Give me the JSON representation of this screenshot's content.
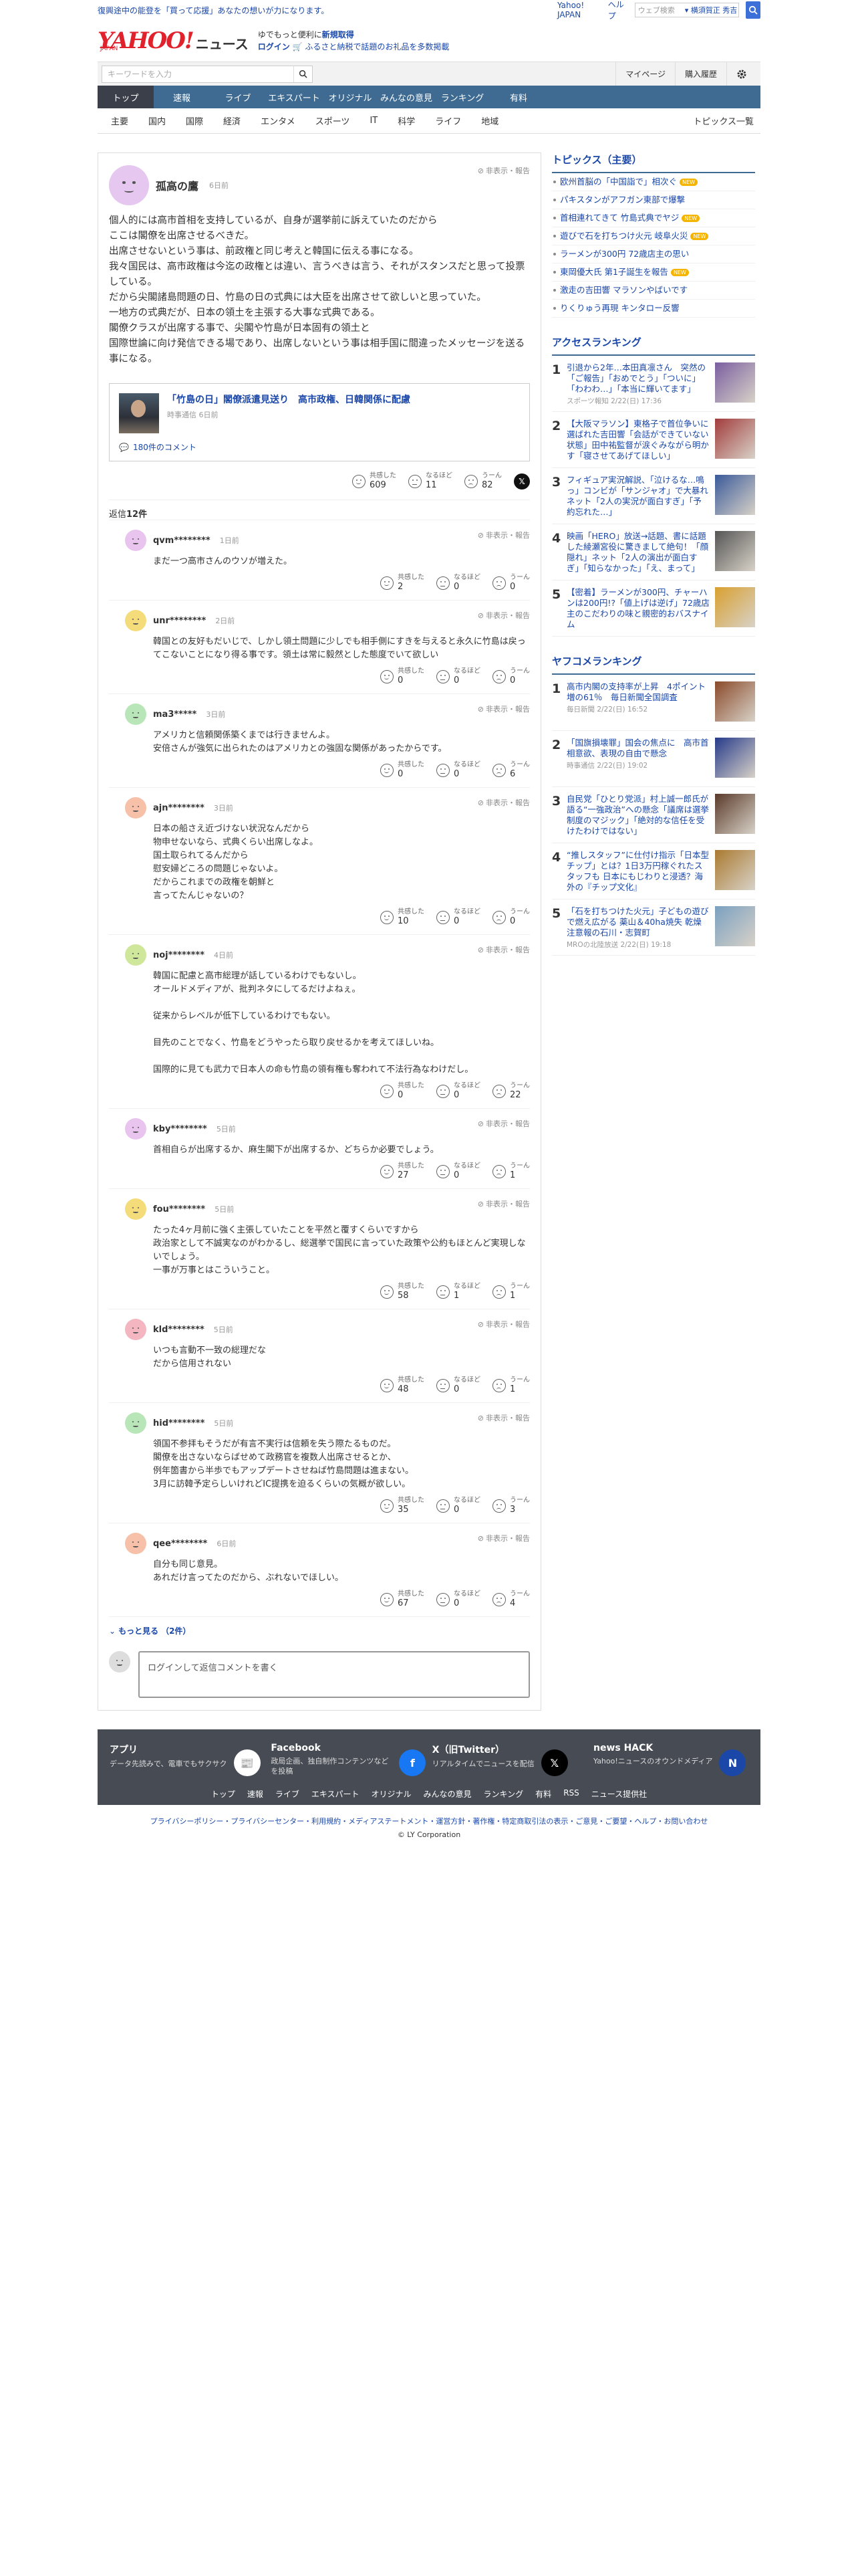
{
  "topbar": {
    "promo": "復興途中の能登を「買って応援」あなたの想いが力になります。",
    "yj": "Yahoo! JAPAN",
    "help": "ヘルプ",
    "search_ph": "ウェブ検索",
    "search_chip": "▾ 横須賀正 秀吉",
    "search_icon": "search-icon"
  },
  "logo": {
    "yahoo": "YAHOO!",
    "japan": "JAPAN",
    "news": "ニュース"
  },
  "promo": {
    "l1a": "ゆでもっと便利に",
    "l1b": "新規取得",
    "l2a": "ログイン",
    "l2b": "ふるさと納税で話題のお礼品を多数掲載"
  },
  "search": {
    "placeholder": "キーワードを入力",
    "mypage": "マイページ",
    "history": "購入履歴"
  },
  "nav": [
    "トップ",
    "速報",
    "ライブ",
    "エキスパート",
    "オリジナル",
    "みんなの意見",
    "ランキング",
    "有料"
  ],
  "subnav": [
    "主要",
    "国内",
    "国際",
    "経済",
    "エンタメ",
    "スポーツ",
    "IT",
    "科学",
    "ライフ",
    "地域"
  ],
  "subnav_last": "トピックス一覧",
  "comment": {
    "user": "孤高の鷹",
    "date": "6日前",
    "hide": "非表示・報告",
    "text": "個人的には高市首相を支持しているが、自身が選挙前に訴えていたのだから\nここは閣僚を出席させるべきだ。\n出席させないという事は、前政権と同じ考えと韓国に伝える事になる。\n我々国民は、高市政権は今迄の政権とは違い、言うべきは言う、それがスタンスだと思って投票している。\nだから尖閣諸島問題の日、竹島の日の式典には大臣を出席させて欲しいと思っていた。\n一地方の式典だが、日本の領土を主張する大事な式典である。\n閣僚クラスが出席する事で、尖閣や竹島が日本固有の領土と\n国際世論に向け発信できる場であり、出席しないという事は相手国に間違ったメッセージを送る事になる。",
    "article_title": "「竹島の日」閣僚派遣見送り　高市政権、日韓関係に配慮",
    "article_src": "時事通信 6日前",
    "article_comments": "180件のコメント",
    "reactions": {
      "agree": "共感した",
      "agree_n": "609",
      "naruhodo": "なるほど",
      "naruhodo_n": "11",
      "hmm": "うーん",
      "hmm_n": "82"
    }
  },
  "reply_label": "返信",
  "reply_count": "12件",
  "replies": [
    {
      "user": "qvm********",
      "date": "1日前",
      "color": "#e8c4ee",
      "text": "まだ一つ高市さんのウソが増えた。",
      "a": "2",
      "b": "0",
      "c": "0"
    },
    {
      "user": "unr********",
      "date": "2日前",
      "color": "#f5dc7a",
      "text": "韓国との友好もだいじで、しかし領土問題に少しでも相手側にすきを与えると永久に竹島は戻ってこないことになり得る事です。領土は常に毅然とした態度でいて欲しい",
      "a": "0",
      "b": "0",
      "c": "0"
    },
    {
      "user": "ma3*****",
      "date": "3日前",
      "color": "#b9e6b8",
      "text": "アメリカと信頼関係築くまでは行きませんよ。\n安倍さんが強気に出られたのはアメリカとの強固な関係があったからです。",
      "a": "0",
      "b": "0",
      "c": "6"
    },
    {
      "user": "ajn********",
      "date": "3日前",
      "color": "#f7c0a8",
      "text": "日本の船さえ近づけない状況なんだから\n物申せないなら、式典くらい出席しなよ。\n国土取られてるんだから\n慰安婦どころの問題じゃないよ。\nだからこれまでの政権を朝鮮と\n言ってたんじゃないの？",
      "a": "10",
      "b": "0",
      "c": "0"
    },
    {
      "user": "noj********",
      "date": "4日前",
      "color": "#cfe79a",
      "text": "韓国に配慮と高市総理が話しているわけでもないし。\nオールドメディアが、批判ネタにしてるだけよねぇ。\n\n従来からレベルが低下しているわけでもない。\n\n目先のことでなく、竹島をどうやったら取り戻せるかを考えてほしいね。\n\n国際的に見ても武力で日本人の命も竹島の領有権も奪われて不法行為なわけだし。",
      "a": "0",
      "b": "0",
      "c": "22"
    },
    {
      "user": "kby********",
      "date": "5日前",
      "color": "#e8c4ee",
      "text": "首相自らが出席するか、麻生閣下が出席するか、どちらか必要でしょう。",
      "a": "27",
      "b": "0",
      "c": "1"
    },
    {
      "user": "fou********",
      "date": "5日前",
      "color": "#f5dc7a",
      "text": "たった4ヶ月前に強く主張していたことを平然と覆すくらいですから\n政治家として不誠実なのがわかるし、総選挙で国民に言っていた政策や公約もほとんど実現しないでしょう。\n一事が万事とはこういうこと。",
      "a": "58",
      "b": "1",
      "c": "1"
    },
    {
      "user": "kld********",
      "date": "5日前",
      "color": "#f4b7c2",
      "text": "いつも言動不一致の総理だな\nだから信用されない",
      "a": "48",
      "b": "0",
      "c": "1"
    },
    {
      "user": "hid********",
      "date": "5日前",
      "color": "#b9e6b8",
      "text": "領国不参拝もそうだが有言不実行は信頼を失う際たるものだ。\n閣僚を出さないならばせめて政務官を複数人出席させるとか、\n例年箇書から半歩でもアップデートさせねば竹島問題は進まない。\n3月に訪韓予定らしいけれどIC提携を迫るくらいの気概が欲しい。",
      "a": "35",
      "b": "0",
      "c": "3"
    },
    {
      "user": "qee********",
      "date": "6日前",
      "color": "#f7c0a8",
      "text": "自分も同じ意見。\nあれだけ言ってたのだから、ぶれないでほしい。",
      "a": "67",
      "b": "0",
      "c": "4"
    }
  ],
  "more_text": "もっと見る",
  "more_count": "（2件）",
  "login_text": "ログインして返信コメントを書く",
  "topics": {
    "title": "トピックス（主要）",
    "items": [
      {
        "t": "欧州首脳の「中国詣で」相次ぐ",
        "new": "NEW"
      },
      {
        "t": "パキスタンがアフガン東部で爆撃",
        "new": ""
      },
      {
        "t": "首相連れてきて 竹島式典でヤジ",
        "new": "NEW"
      },
      {
        "t": "遊びで石を打ちつけ火元 岐阜火災",
        "new": "NEW"
      },
      {
        "t": "ラーメンが300円 72歳店主の思い",
        "new": ""
      },
      {
        "t": "東岡優大氏 第1子誕生を報告",
        "new": "NEW"
      },
      {
        "t": "激走の吉田響 マラソンやばいです",
        "new": ""
      },
      {
        "t": "りくりゅう再現 キンタロー反響",
        "new": ""
      }
    ]
  },
  "access": {
    "title": "アクセスランキング",
    "items": [
      {
        "n": "1",
        "t": "引退から2年…本田真凛さん　突然の「ご報告」「おめでとう」「ついに」「わわわ…」「本当に輝いてます」",
        "s": "スポーツ報知 2/22(日) 17:36",
        "im": "#7a5ea0"
      },
      {
        "n": "2",
        "t": "【大阪マラソン】東格子で首位争いに選ばれた吉田響「会話ができていない状態」田中祐監督が涙ぐみながら明かす「寝させてあげてほしい」",
        "s": "デイリースポーツ 2/22(日) 12:15",
        "im": "#a23c3c"
      },
      {
        "n": "3",
        "t": "フィギュア実況解説、「泣けるな…鳴っ」コンビが「サンジャオ」で大暴れ　ネット「2人の実況が面白すぎ」「予約忘れた…」",
        "s": "中日スポーツ 2/22(日) 16:29",
        "im": "#3a5a9a"
      },
      {
        "n": "4",
        "t": "映画「HERO」放送→話題、書に話題した綾瀬宮役に驚きまして絶句！「顔隠れ」ネット「2人の演出が面白すぎ」「知らなかった」「え、まって」",
        "s": "デイリースポーツ 2/22(日) 17:44",
        "im": "#555555"
      },
      {
        "n": "5",
        "t": "【密着】ラーメンが300円、チャーハンは200円!?「値上げは逆げ」72歳店主のこだわりの味と親密的おバスナイム",
        "s": "読売テレビ 2/22(日) 12:00",
        "im": "#d9a030"
      }
    ]
  },
  "yahoo_rank": {
    "title": "ヤフコメランキング",
    "items": [
      {
        "n": "1",
        "t": "高市内閣の支持率が上昇　4ポイント増の61％　毎日新聞全国調査",
        "s": "毎日新聞 2/22(日) 16:52",
        "im": "#8a4a2a"
      },
      {
        "n": "2",
        "t": "「国旗損壊罪」国会の焦点に　高市首相意欲、表現の自由で懸念",
        "s": "時事通信 2/22(日) 19:02",
        "im": "#263a8a"
      },
      {
        "n": "3",
        "t": "自民党「ひとり党派」村上誠一郎氏が語る“一強政治”への懸念「議席は選挙制度のマジック」「絶対的な信任を受けたわけではない」",
        "s": "AERA DIGITAL 2/22(日) 9:30",
        "im": "#5a3a2a"
      },
      {
        "n": "4",
        "t": "“推しスタッフ”に仕付け指示「日本型チップ」とは？1日3万円稼ぐれたスタッフも 日本にもじわりと浸透？海外の『チップ文化』",
        "s": "ABEMA TIMES 2/22(日) 12:00",
        "im": "#aa7a30"
      },
      {
        "n": "5",
        "t": "「石を打ちつけた火元」子どもの遊びで燃え広がる 薬山＆40ha焼失 乾燥注意報の石川・志賀町",
        "s": "MROの北陸放送 2/22(日) 19:18",
        "im": "#7aa0c0"
      }
    ]
  },
  "footer": {
    "apps": [
      {
        "t": "アプリ",
        "d": "データ先読みで、電車でもサクサク",
        "ic": "app-icon",
        "c": "#ffffff",
        "g": "📰"
      },
      {
        "t": "Facebook",
        "d": "政局企画、独自制作コンテンツなどを投稿",
        "ic": "facebook-icon",
        "c": "#1877f2",
        "g": "f"
      },
      {
        "t": "X（旧Twitter）",
        "d": "リアルタイムでニュースを配信",
        "ic": "x-icon",
        "c": "#000000",
        "g": "𝕏"
      },
      {
        "t": "news HACK",
        "d": "Yahoo!ニュースのオウンドメディア",
        "ic": "newshack-icon",
        "c": "#1a47a8",
        "g": "N"
      }
    ],
    "links": [
      "トップ",
      "速報",
      "ライブ",
      "エキスパート",
      "オリジナル",
      "みんなの意見",
      "ランキング",
      "有料",
      "RSS",
      "ニュース提供社"
    ],
    "bottom": "プライバシーポリシー・プライバシーセンター・利用規約・メディアステートメント・運営方針・著作権・特定商取引法の表示・ご意見・ご要望・ヘルプ・お問い合わせ",
    "copyright": "© LY Corporation"
  }
}
